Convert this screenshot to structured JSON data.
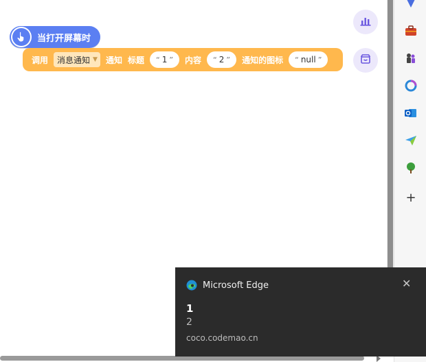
{
  "hat_block": {
    "label": "当打开屏幕时"
  },
  "call_block": {
    "call_label": "调用",
    "dropdown_value": "消息通知",
    "notify_label": "通知",
    "title_label": "标题",
    "title_value": "1",
    "content_label": "内容",
    "content_value": "2",
    "icon_label": "通知的图标",
    "icon_value": "null",
    "quote_open": "“",
    "quote_close": "”"
  },
  "right_buttons": [
    "chart-icon",
    "store-icon"
  ],
  "edge_sidebar": [
    "favorites-icon",
    "tools-icon",
    "games-icon",
    "microsoft365-icon",
    "outlook-icon",
    "send-icon",
    "tree-icon",
    "add-icon"
  ],
  "notification": {
    "app_name": "Microsoft Edge",
    "title": "1",
    "body": "2",
    "source": "coco.codemao.cn",
    "close_glyph": "✕"
  },
  "colors": {
    "hat_block": "#5b7ff2",
    "call_block": "#ffb84d",
    "toast_bg": "#2b2b2b"
  }
}
